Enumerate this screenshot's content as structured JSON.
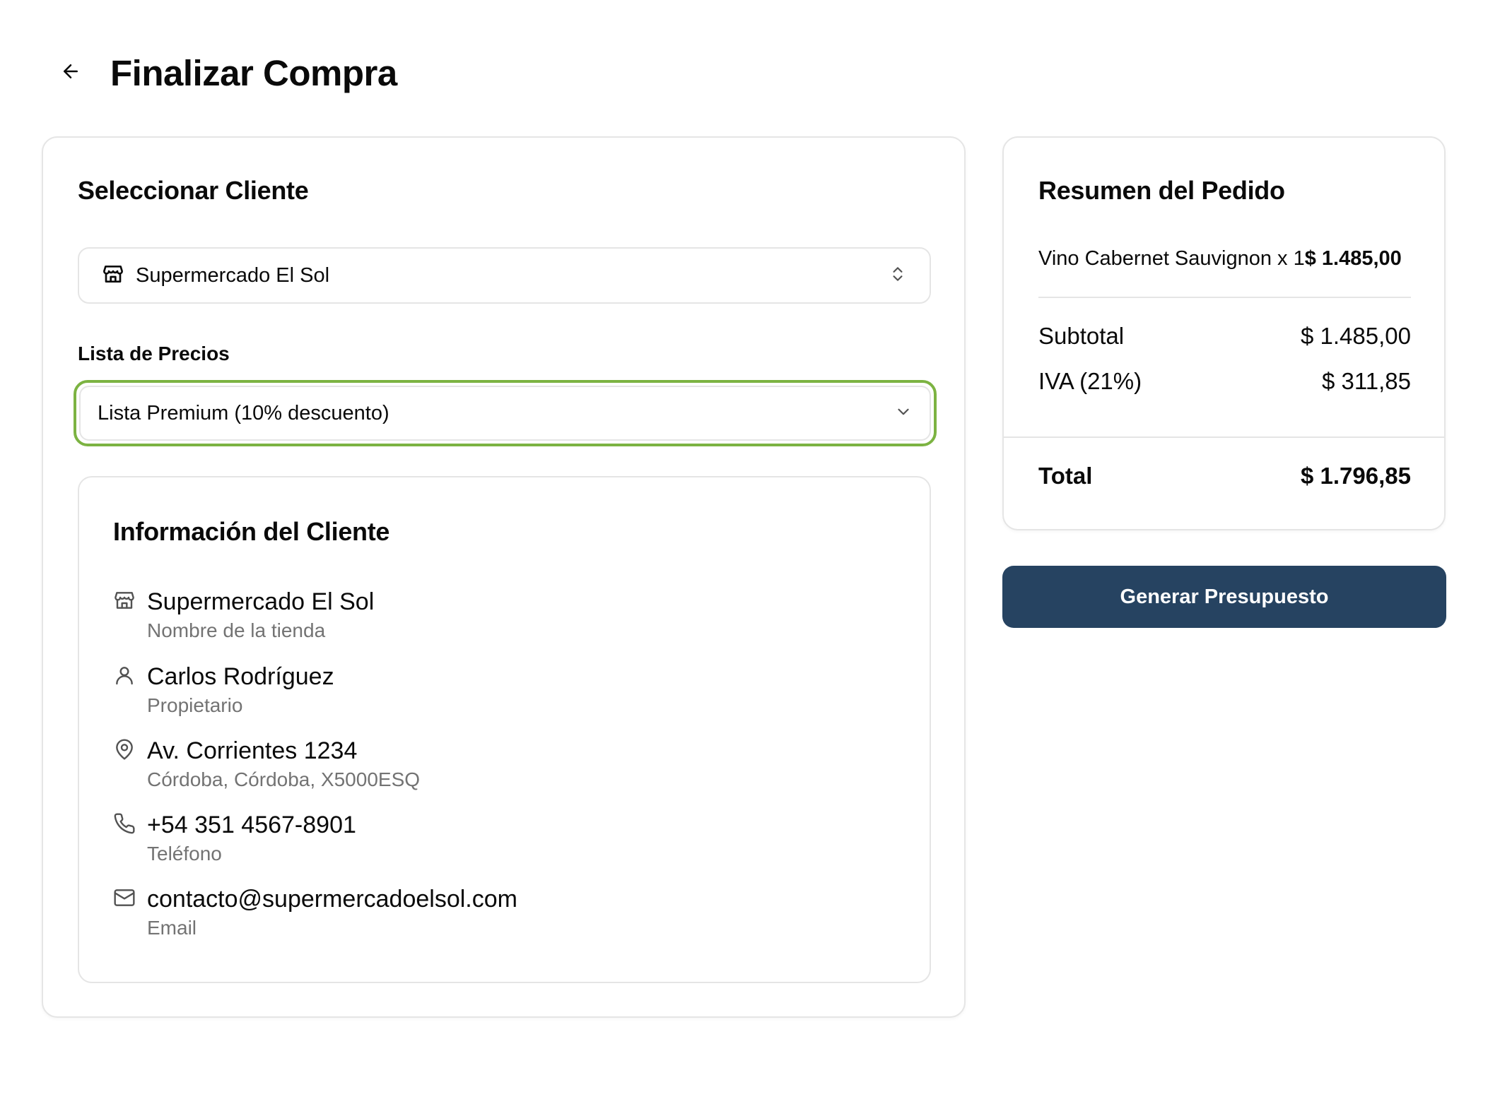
{
  "header": {
    "title": "Finalizar Compra",
    "back_icon": "arrow-left-icon"
  },
  "client_section": {
    "title": "Seleccionar Cliente",
    "selected_client": "Supermercado El Sol",
    "client_icon": "store-icon",
    "selector_icon": "chevrons-up-down-icon"
  },
  "price_list": {
    "label": "Lista de Precios",
    "selected": "Lista Premium (10% descuento)",
    "dropdown_icon": "chevron-down-icon",
    "focus_color": "#7cb342"
  },
  "client_info": {
    "title": "Información del Cliente",
    "items": [
      {
        "icon": "store-icon",
        "primary": "Supermercado El Sol",
        "secondary": "Nombre de la tienda"
      },
      {
        "icon": "user-icon",
        "primary": "Carlos Rodríguez",
        "secondary": "Propietario"
      },
      {
        "icon": "map-pin-icon",
        "primary": "Av. Corrientes 1234",
        "secondary": "Córdoba, Córdoba, X5000ESQ"
      },
      {
        "icon": "phone-icon",
        "primary": "+54 351 4567-8901",
        "secondary": "Teléfono"
      },
      {
        "icon": "mail-icon",
        "primary": "contacto@supermercadoelsol.com",
        "secondary": "Email"
      }
    ]
  },
  "order_summary": {
    "title": "Resumen del Pedido",
    "line_items": [
      {
        "description": "Vino Cabernet Sauvignon x 1",
        "amount": "$ 1.485,00"
      }
    ],
    "subtotal_label": "Subtotal",
    "subtotal_value": "$ 1.485,00",
    "tax_label": "IVA (21%)",
    "tax_value": "$ 311,85",
    "total_label": "Total",
    "total_value": "$ 1.796,85"
  },
  "actions": {
    "generate_label": "Generar Presupuesto",
    "primary_color": "#264361"
  }
}
